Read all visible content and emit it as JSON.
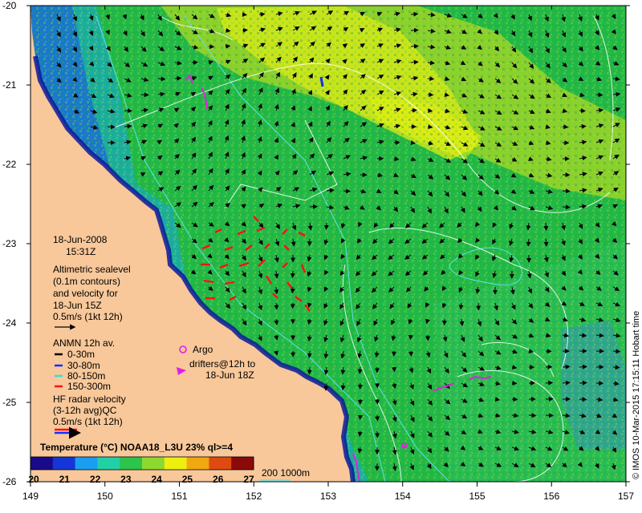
{
  "map": {
    "lon_range": [
      149,
      157
    ],
    "lat_range": [
      -26,
      -20
    ],
    "x_ticks": [
      "149",
      "150",
      "151",
      "152",
      "153",
      "154",
      "155",
      "156",
      "157"
    ],
    "y_ticks": [
      "-20",
      "-21",
      "-22",
      "-23",
      "-24",
      "-25",
      "-26"
    ],
    "land_color": "#f8c89a",
    "coast_shelf_color": "#0a1a9a"
  },
  "legend": {
    "date": "18-Jun-2008",
    "time": "15:31Z",
    "altimetry_lines": [
      "Altimetric sealevel",
      "(0.1m contours)",
      "and velocity for",
      "18-Jun 15Z",
      "0.5m/s (1kt 12h)"
    ],
    "anmn_title": "ANMN 12h av.",
    "anmn_items": [
      {
        "label": "0-30m",
        "color": "#000000"
      },
      {
        "label": "30-80m",
        "color": "#1030ff"
      },
      {
        "label": "80-150m",
        "color": "#30e0e0"
      },
      {
        "label": "150-300m",
        "color": "#ff1010"
      }
    ],
    "argo_label": "Argo",
    "drifter_lines": [
      "drifters@12h to",
      "18-Jun 18Z"
    ],
    "hf_lines": [
      "HF radar velocity",
      "(3-12h avg)QC",
      "0.5m/s (1kt 12h)"
    ],
    "argo_color": "#e020e0"
  },
  "colorbar": {
    "title": "Temperature (°C) NOAA18_L3U 23% ql>=4",
    "ticks": [
      "20",
      "21",
      "22",
      "23",
      "24",
      "25",
      "26",
      "27"
    ],
    "colors": [
      "#1a0a8a",
      "#1436d8",
      "#1a9ef0",
      "#22d0a8",
      "#2cc44a",
      "#8ed830",
      "#eeee10",
      "#f0a810",
      "#e04a10",
      "#8a0a0a"
    ]
  },
  "isobath_label": "200 1000m",
  "credit": "© IMOS 10-Mar-2015 17:15:11 Hobart time"
}
